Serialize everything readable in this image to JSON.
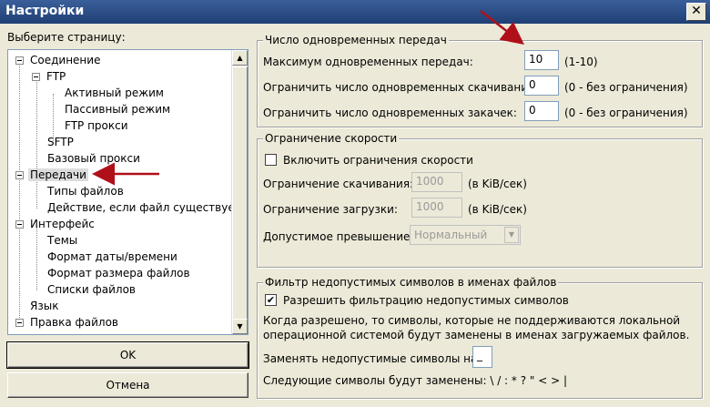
{
  "window": {
    "title": "Настройки"
  },
  "left": {
    "label": "Выберите страницу:",
    "tree": [
      {
        "label": "Соединение"
      },
      {
        "label": "FTP"
      },
      {
        "label": "Активный режим"
      },
      {
        "label": "Пассивный режим"
      },
      {
        "label": "FTP прокси"
      },
      {
        "label": "SFTP"
      },
      {
        "label": "Базовый прокси"
      },
      {
        "label": "Передачи"
      },
      {
        "label": "Типы файлов"
      },
      {
        "label": "Действие, если файл существует"
      },
      {
        "label": "Интерфейс"
      },
      {
        "label": "Темы"
      },
      {
        "label": "Формат даты/времени"
      },
      {
        "label": "Формат размера файлов"
      },
      {
        "label": "Списки файлов"
      },
      {
        "label": "Язык"
      },
      {
        "label": "Правка файлов"
      }
    ],
    "ok_label": "OK",
    "cancel_label": "Отмена"
  },
  "concurrent": {
    "title": "Число одновременных передач",
    "max_label": "Максимум одновременных передач:",
    "max_value": "10",
    "max_hint": "(1-10)",
    "downloads_label": "Ограничить число одновременных скачиваний:",
    "downloads_value": "0",
    "downloads_hint": "(0 - без ограничения)",
    "uploads_label": "Ограничить число одновременных закачек:",
    "uploads_value": "0",
    "uploads_hint": "(0 - без ограничения)"
  },
  "speed": {
    "title": "Ограничение скорости",
    "enable_label": "Включить ограничения скорости",
    "enable_checked": false,
    "download_label": "Ограничение скачивания:",
    "download_value": "1000",
    "download_unit": "(в KiB/сек)",
    "upload_label": "Ограничение загрузки:",
    "upload_value": "1000",
    "upload_unit": "(в KiB/сек)",
    "burst_label": "Допустимое превышение:",
    "burst_value": "Нормальный"
  },
  "filter": {
    "title": "Фильтр недопустимых символов в именах файлов",
    "enable_label": "Разрешить фильтрацию недопустимых символов",
    "enable_checked": true,
    "checkmark": "✔",
    "description_line1": "Когда разрешено, то символы, которые не поддерживаются локальной",
    "description_line2": "операционной системой будут заменены в именах загружаемых файлов.",
    "replace_label": "Заменять недопустимые символы на:",
    "replace_value": "_",
    "replaced_label": "Следующие символы будут заменены: \\ / : * ? \" < > |"
  },
  "colors": {
    "annotation_arrow": "#b0101a",
    "titlebar": "#1f3f74"
  }
}
